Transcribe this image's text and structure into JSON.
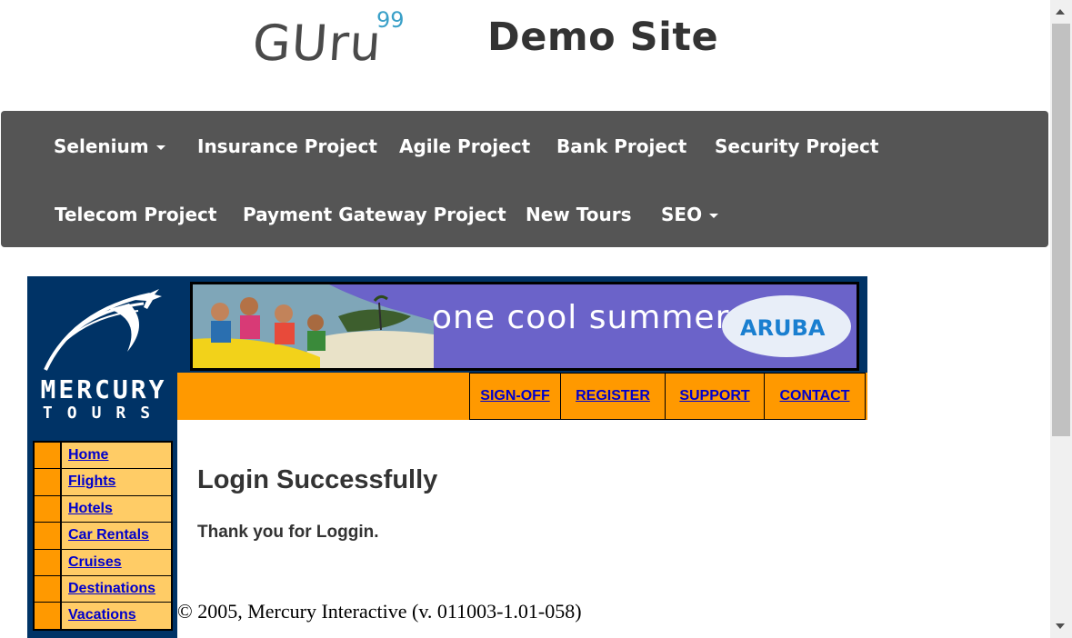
{
  "header": {
    "logo_text": "GUru",
    "logo_superscript": "99",
    "title": "Demo Site"
  },
  "nav": {
    "items": [
      {
        "label": "Selenium",
        "dropdown": true
      },
      {
        "label": "Insurance Project",
        "dropdown": false
      },
      {
        "label": "Agile Project",
        "dropdown": false
      },
      {
        "label": "Bank Project",
        "dropdown": false
      },
      {
        "label": "Security Project",
        "dropdown": false
      },
      {
        "label": "Telecom Project",
        "dropdown": false
      },
      {
        "label": "Payment Gateway Project",
        "dropdown": false
      },
      {
        "label": "New Tours",
        "dropdown": false
      },
      {
        "label": "SEO",
        "dropdown": true
      }
    ]
  },
  "mercury": {
    "logo_line1": "MERCURY",
    "logo_line2": "TOURS",
    "banner_text": "one cool summer",
    "banner_brand": "ARUBA",
    "top_links": [
      "SIGN-OFF",
      "REGISTER",
      "SUPPORT",
      "CONTACT"
    ],
    "sidebar": [
      "Home",
      "Flights",
      "Hotels",
      "Car Rentals",
      "Cruises",
      "Destinations",
      "Vacations"
    ],
    "heading": "Login Successfully",
    "message": "Thank you for Loggin.",
    "copyright": "© 2005, Mercury Interactive (v. 011003-1.01-058)"
  },
  "colors": {
    "navbar": "#555555",
    "mercury_blue": "#003366",
    "mercury_orange": "#ff9900",
    "sidebar_yellow": "#ffcc66",
    "link": "#0000cc"
  }
}
